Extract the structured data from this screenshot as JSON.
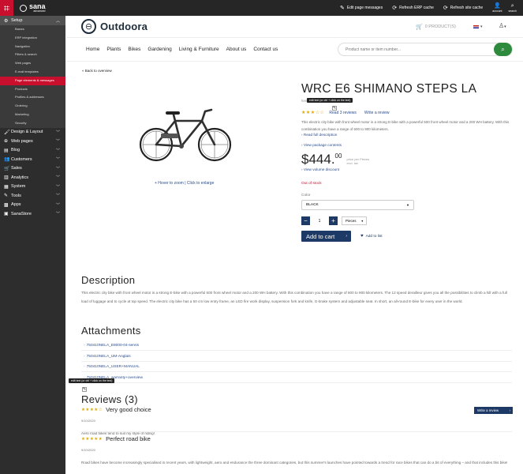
{
  "topbar": {
    "brand_name": "sana",
    "brand_sub": "advanced",
    "actions": [
      {
        "icon": "pencil-icon",
        "label": "Edit page messages"
      },
      {
        "icon": "refresh-icon",
        "label": "Refresh ERP cache"
      },
      {
        "icon": "refresh-icon",
        "label": "Refresh site cache"
      }
    ],
    "account_label": "account",
    "search_label": "search"
  },
  "sidebar": {
    "setup_label": "Setup",
    "setup_items": [
      "Basics",
      "ERP integration",
      "Navigation",
      "Filters & search",
      "Web pages",
      "E-mail templates",
      "Page elements & messages",
      "Products",
      "Profiles & addresses",
      "Ordering",
      "Marketing",
      "Security"
    ],
    "active_item": "Page elements & messages",
    "items": [
      {
        "icon": "brush-icon",
        "label": "Design & Layout"
      },
      {
        "icon": "globe-icon",
        "label": "Web pages"
      },
      {
        "icon": "blog-icon",
        "label": "Blog"
      },
      {
        "icon": "customers-icon",
        "label": "Customers"
      },
      {
        "icon": "sales-icon",
        "label": "Sales"
      },
      {
        "icon": "analytics-icon",
        "label": "Analytics"
      },
      {
        "icon": "system-icon",
        "label": "System"
      },
      {
        "icon": "tools-icon",
        "label": "Tools"
      },
      {
        "icon": "apps-icon",
        "label": "Apps"
      },
      {
        "icon": "store-icon",
        "label": "SanaStore"
      }
    ]
  },
  "site": {
    "logo_text": "Outdoora",
    "cart_label": "0 PRODUCT(S)",
    "nav": [
      "Home",
      "Plants",
      "Bikes",
      "Gardening",
      "Living & Furniture",
      "About us",
      "Contact us"
    ],
    "search_placeholder": "Product name or item number..."
  },
  "product": {
    "back_link": "« Back to overview",
    "zoom_hint": "+ Hover to zoom | Click to enlarge",
    "title": "WRC E6 SHIMANO STEPS LA",
    "item_no": "Item",
    "edit_tooltip": "edit text (or ctrl + click on the text)",
    "rating": 3,
    "reviews_link": "Read 3 reviews",
    "write_review_link": "Write a review",
    "short_description": "This electric city bike with front wheel motor is a strong E-bike with a powerful 500 front wheel motor and a 200 WH battery. With this combination you have a range of 600 to 900 kilometers.",
    "read_more": "› Read full description",
    "package_link": "› View package contents",
    "price_main": "$444.",
    "price_cents": "00",
    "price_unit": "price per Pieces",
    "price_tax": "excl. tax",
    "volume_link": "› View volume discount",
    "stock": "Out of stock",
    "color_label": "Color",
    "color_value": "BLACK",
    "quantity": "1",
    "unit_value": "Pieces",
    "add_to_cart": "Add to cart",
    "wishlist": "Add to list"
  },
  "description": {
    "heading": "Description",
    "text": "This electric city bike with front wheel motor is a strong E-bike with a powerful 500 front wheel motor and a 200 WH battery. With this combination you have a range of 600 to 900 kilometers. The 12 speed derailleur gives you all the possibilities to climb a hill with a full load of luggage and to cycle at top speed. The electric city bike has a 50 cm low entry frame, an LED fire work display, suspension fork and knife, G-brake system and adjustable seat. In short, an all-round E-bike for every user in the world."
  },
  "attachments": {
    "heading": "Attachments",
    "items": [
      "750410NELA_E8000-04-sereis",
      "750410NELA_UM-Anglais",
      "750410NELA_USER+MANUAL",
      "750410NELA_warranty+overview"
    ],
    "edit_tooltip": "edit text (or ctrl + click on the text)"
  },
  "reviews": {
    "heading": "Reviews (3)",
    "write_review": "Write a review",
    "items": [
      {
        "stars": 4,
        "title": "Very good choice",
        "date": "9/10/2020",
        "text": "Aero road bikes tend to suit my style of riding!"
      },
      {
        "stars": 5,
        "title": "Perfect road bike",
        "date": "9/10/2020",
        "text": "Road bikes have become increasingly specialised in recent years, with lightweight, aero and endurance the three dominant categories, but this summer's launches have pointed towards a trend for race bikes that can do a bit of everything – and that includes this bike!"
      }
    ]
  },
  "colors": {
    "brand_red": "#c8102e",
    "navy": "#1d3a66",
    "green": "#2e8b3e",
    "star": "#e0a800"
  }
}
